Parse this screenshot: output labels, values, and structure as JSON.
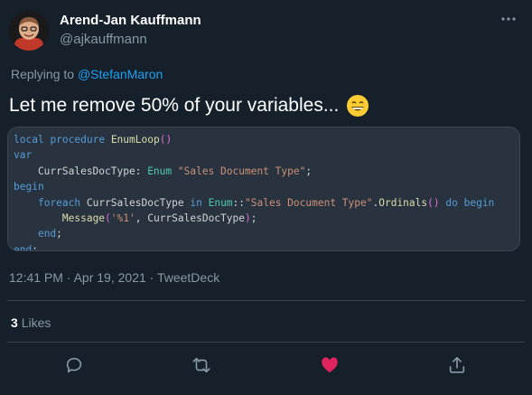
{
  "author": {
    "name": "Arend-Jan Kauffmann",
    "handle": "@ajkauffmann"
  },
  "reply": {
    "prefix": "Replying to ",
    "to": "@StefanMaron"
  },
  "tweet": {
    "text": "Let me remove 50% of your variables...",
    "emoji": "grinning-face-emoji"
  },
  "code": {
    "lines": [
      "local procedure EnumLoop()",
      "var",
      "    CurrSalesDocType: Enum \"Sales Document Type\";",
      "begin",
      "    foreach CurrSalesDocType in Enum::\"Sales Document Type\".Ordinals() do begin",
      "        Message('%1', CurrSalesDocType);",
      "    end;",
      "end;"
    ]
  },
  "meta": {
    "time": "12:41 PM",
    "date": "Apr 19, 2021",
    "source": "TweetDeck",
    "full": "12:41 PM · Apr 19, 2021 · TweetDeck"
  },
  "stats": {
    "likes_count": "3",
    "likes_label": "Likes"
  },
  "actions": {
    "reply": "reply-icon",
    "retweet": "retweet-icon",
    "like": "heart-icon",
    "share": "share-icon"
  },
  "colors": {
    "background": "#15202b",
    "link": "#1da1f2",
    "secondary": "#8899a6",
    "like": "#e0245e"
  }
}
